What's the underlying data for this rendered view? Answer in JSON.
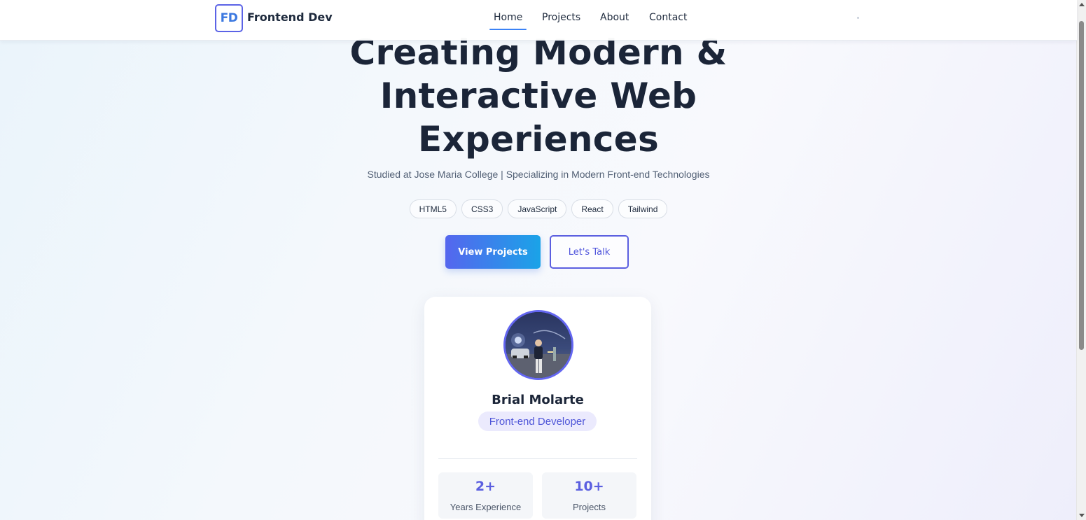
{
  "nav": {
    "logo_initials": "FD",
    "logo_text": "Frontend Dev",
    "links": [
      {
        "label": "Home",
        "active": true
      },
      {
        "label": "Projects",
        "active": false
      },
      {
        "label": "About",
        "active": false
      },
      {
        "label": "Contact",
        "active": false
      }
    ]
  },
  "hero": {
    "title_lines": [
      "Creating Modern &",
      "Interactive Web",
      "Experiences"
    ],
    "subtitle": "Studied at Jose Maria College | Specializing in Modern Front-end Technologies",
    "tags": [
      "HTML5",
      "CSS3",
      "JavaScript",
      "React",
      "Tailwind"
    ],
    "primary_button": "View Projects",
    "secondary_button": "Let's Talk"
  },
  "profile": {
    "name": "Brial Molarte",
    "role": "Front-end Developer",
    "stats": [
      {
        "value": "2+",
        "label": "Years Experience"
      },
      {
        "value": "10+",
        "label": "Projects"
      }
    ]
  },
  "colors": {
    "accent": "#6366f1",
    "primary_gradient_start": "#5566ee",
    "primary_gradient_end": "#1aa3e8",
    "heading": "#1b2538",
    "nav_underline": "#3b82f6"
  },
  "icons": {
    "avatar": "profile-photo"
  }
}
